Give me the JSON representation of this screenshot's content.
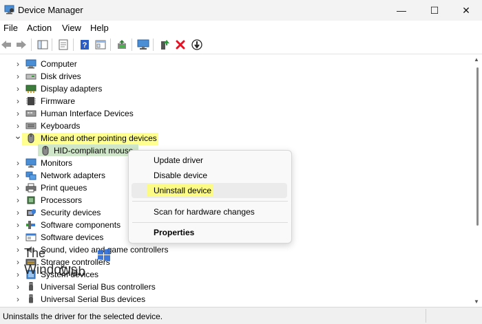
{
  "window": {
    "title": "Device Manager",
    "controls": {
      "minimize": "—",
      "maximize": "☐",
      "close": "✕"
    }
  },
  "menubar": [
    "File",
    "Action",
    "View",
    "Help"
  ],
  "tree": [
    {
      "label": "Computer",
      "icon": "computer-icon",
      "expanded": false
    },
    {
      "label": "Disk drives",
      "icon": "disk-drive-icon",
      "expanded": false
    },
    {
      "label": "Display adapters",
      "icon": "display-adapter-icon",
      "expanded": false
    },
    {
      "label": "Firmware",
      "icon": "firmware-icon",
      "expanded": false
    },
    {
      "label": "Human Interface Devices",
      "icon": "hid-icon",
      "expanded": false
    },
    {
      "label": "Keyboards",
      "icon": "keyboard-icon",
      "expanded": false
    },
    {
      "label": "Mice and other pointing devices",
      "icon": "mouse-icon",
      "expanded": true
    },
    {
      "label": "HID-compliant mouse",
      "icon": "mouse-icon",
      "child": true
    },
    {
      "label": "Monitors",
      "icon": "monitor-icon",
      "expanded": false
    },
    {
      "label": "Network adapters",
      "icon": "network-adapter-icon",
      "expanded": false
    },
    {
      "label": "Print queues",
      "icon": "printer-icon",
      "expanded": false
    },
    {
      "label": "Processors",
      "icon": "processor-icon",
      "expanded": false
    },
    {
      "label": "Security devices",
      "icon": "security-device-icon",
      "expanded": false
    },
    {
      "label": "Software components",
      "icon": "software-component-icon",
      "expanded": false
    },
    {
      "label": "Software devices",
      "icon": "software-device-icon",
      "expanded": false
    },
    {
      "label": "Sound, video and game controllers",
      "icon": "speaker-icon",
      "expanded": false
    },
    {
      "label": "Storage controllers",
      "icon": "storage-controller-icon",
      "expanded": false
    },
    {
      "label": "System devices",
      "icon": "system-device-icon",
      "expanded": false
    },
    {
      "label": "Universal Serial Bus controllers",
      "icon": "usb-icon",
      "expanded": false
    },
    {
      "label": "Universal Serial Bus devices",
      "icon": "usb-icon",
      "expanded": false
    }
  ],
  "context_menu": {
    "update_driver": "Update driver",
    "disable_device": "Disable device",
    "uninstall_device": "Uninstall device",
    "scan": "Scan for hardware changes",
    "properties": "Properties"
  },
  "watermark": {
    "line1": "The",
    "line2a": "Windows",
    "line2b": "Club"
  },
  "status": "Uninstalls the driver for the selected device.",
  "colors": {
    "highlight_yellow": "#ffff6b",
    "selected_green": "#d0e6c8",
    "delete_red": "#e81123",
    "accent_blue": "#2b6bd6"
  }
}
